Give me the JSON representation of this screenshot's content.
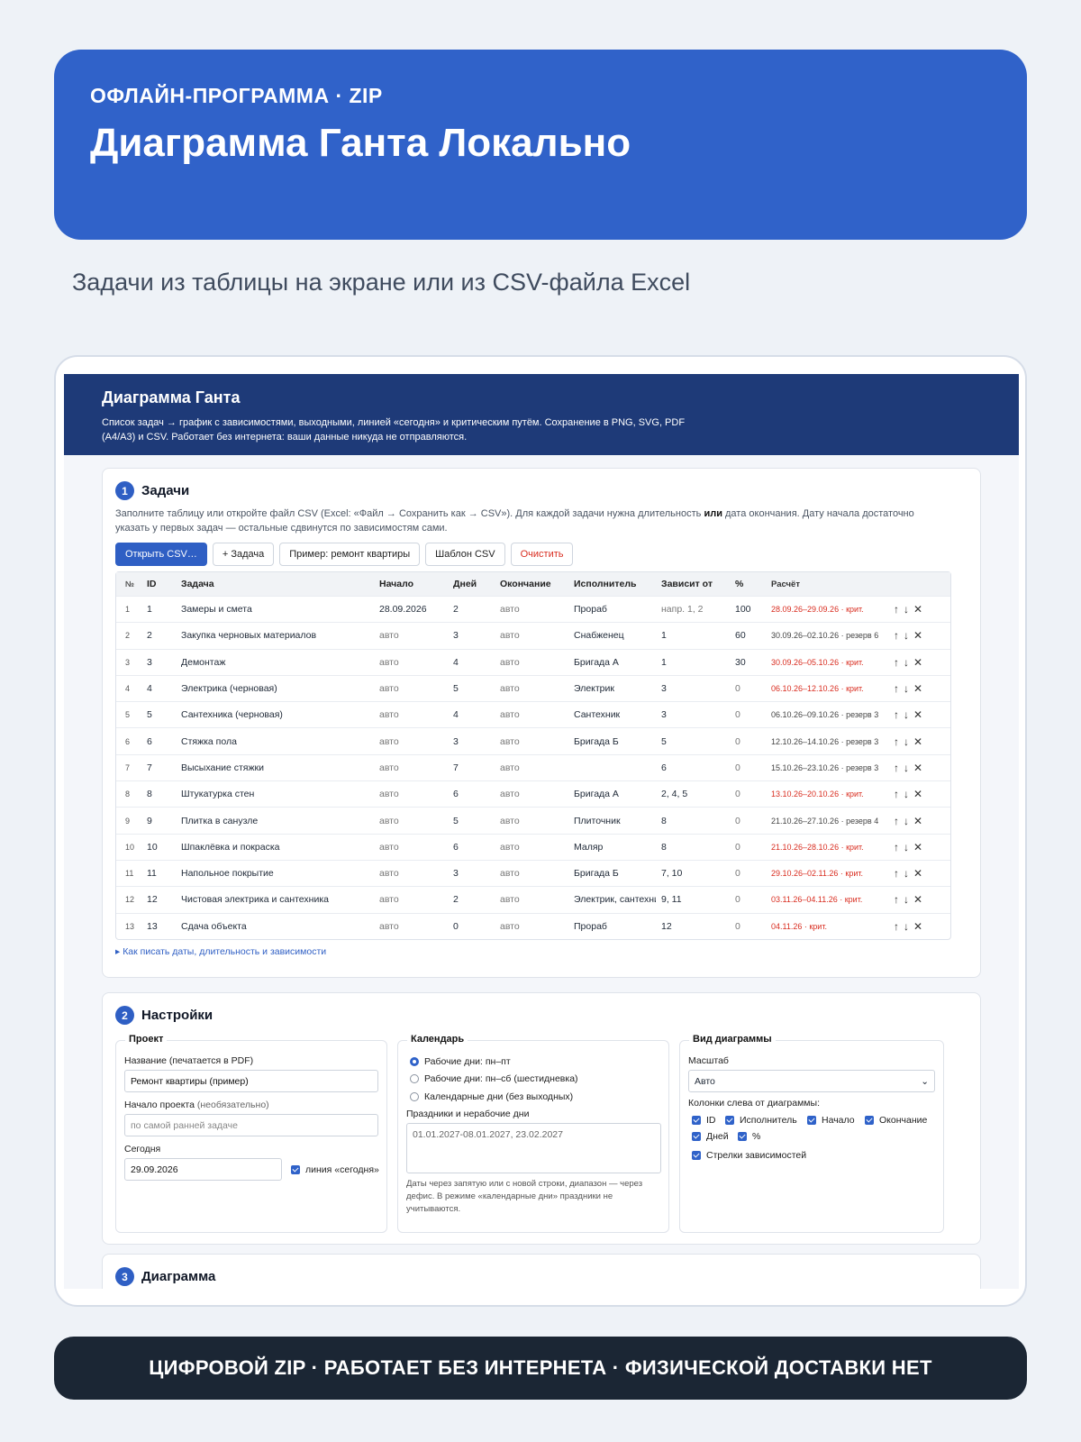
{
  "hero": {
    "kicker": "ОФЛАЙН-ПРОГРАММА · ZIP",
    "title": "Диаграмма Ганта Локально"
  },
  "subtitle": "Задачи из таблицы на экране или из CSV-файла Excel",
  "app": {
    "title": "Диаграмма Ганта",
    "description": "Список задач → график с зависимостями, выходными, линией «сегодня» и критическим путём. Сохранение в PNG, SVG, PDF (A4/A3) и CSV. Работает без интернета: ваши данные никуда не отправляются."
  },
  "tasks": {
    "number": "1",
    "title": "Задачи",
    "hint_pre": "Заполните таблицу или откройте файл CSV (Excel: «Файл → Сохранить как → CSV»). Для каждой задачи нужна длительность ",
    "hint_bold": "или",
    "hint_post": " дата окончания. Дату начала достаточно указать у первых задач — остальные сдвинутся по зависимостям сами.",
    "buttons": {
      "open_csv": "Открыть CSV…",
      "add_task": "+ Задача",
      "example": "Пример: ремонт квартиры",
      "template": "Шаблон CSV",
      "clear": "Очистить"
    },
    "columns": {
      "no": "№",
      "id": "ID",
      "name": "Задача",
      "start": "Начало",
      "days": "Дней",
      "end": "Окончание",
      "assignee": "Исполнитель",
      "depends": "Зависит от",
      "pct": "%",
      "calc": "Расчёт"
    },
    "rows": [
      {
        "no": "1",
        "id": "1",
        "name": "Замеры и смета",
        "start": "28.09.2026",
        "days": "2",
        "end": "авто",
        "assignee": "Прораб",
        "depends": "напр. 1, 2",
        "pct": "100",
        "calc": "28.09.26–29.09.26 · крит.",
        "crit": true
      },
      {
        "no": "2",
        "id": "2",
        "name": "Закупка черновых материалов",
        "start": "авто",
        "days": "3",
        "end": "авто",
        "assignee": "Снабженец",
        "depends": "1",
        "pct": "60",
        "calc": "30.09.26–02.10.26 · резерв 6",
        "crit": false
      },
      {
        "no": "3",
        "id": "3",
        "name": "Демонтаж",
        "start": "авто",
        "days": "4",
        "end": "авто",
        "assignee": "Бригада А",
        "depends": "1",
        "pct": "30",
        "calc": "30.09.26–05.10.26 · крит.",
        "crit": true
      },
      {
        "no": "4",
        "id": "4",
        "name": "Электрика (черновая)",
        "start": "авто",
        "days": "5",
        "end": "авто",
        "assignee": "Электрик",
        "depends": "3",
        "pct": "0",
        "calc": "06.10.26–12.10.26 · крит.",
        "crit": true
      },
      {
        "no": "5",
        "id": "5",
        "name": "Сантехника (черновая)",
        "start": "авто",
        "days": "4",
        "end": "авто",
        "assignee": "Сантехник",
        "depends": "3",
        "pct": "0",
        "calc": "06.10.26–09.10.26 · резерв 3",
        "crit": false
      },
      {
        "no": "6",
        "id": "6",
        "name": "Стяжка пола",
        "start": "авто",
        "days": "3",
        "end": "авто",
        "assignee": "Бригада Б",
        "depends": "5",
        "pct": "0",
        "calc": "12.10.26–14.10.26 · резерв 3",
        "crit": false
      },
      {
        "no": "7",
        "id": "7",
        "name": "Высыхание стяжки",
        "start": "авто",
        "days": "7",
        "end": "авто",
        "assignee": "",
        "depends": "6",
        "pct": "0",
        "calc": "15.10.26–23.10.26 · резерв 3",
        "crit": false
      },
      {
        "no": "8",
        "id": "8",
        "name": "Штукатурка стен",
        "start": "авто",
        "days": "6",
        "end": "авто",
        "assignee": "Бригада А",
        "depends": "2, 4, 5",
        "pct": "0",
        "calc": "13.10.26–20.10.26 · крит.",
        "crit": true
      },
      {
        "no": "9",
        "id": "9",
        "name": "Плитка в санузле",
        "start": "авто",
        "days": "5",
        "end": "авто",
        "assignee": "Плиточник",
        "depends": "8",
        "pct": "0",
        "calc": "21.10.26–27.10.26 · резерв 4",
        "crit": false
      },
      {
        "no": "10",
        "id": "10",
        "name": "Шпаклёвка и покраска",
        "start": "авто",
        "days": "6",
        "end": "авто",
        "assignee": "Маляр",
        "depends": "8",
        "pct": "0",
        "calc": "21.10.26–28.10.26 · крит.",
        "crit": true
      },
      {
        "no": "11",
        "id": "11",
        "name": "Напольное покрытие",
        "start": "авто",
        "days": "3",
        "end": "авто",
        "assignee": "Бригада Б",
        "depends": "7, 10",
        "pct": "0",
        "calc": "29.10.26–02.11.26 · крит.",
        "crit": true
      },
      {
        "no": "12",
        "id": "12",
        "name": "Чистовая электрика и сантехника",
        "start": "авто",
        "days": "2",
        "end": "авто",
        "assignee": "Электрик, сантехник",
        "depends": "9, 11",
        "pct": "0",
        "calc": "03.11.26–04.11.26 · крит.",
        "crit": true
      },
      {
        "no": "13",
        "id": "13",
        "name": "Сдача объекта",
        "start": "авто",
        "days": "0",
        "end": "авто",
        "assignee": "Прораб",
        "depends": "12",
        "pct": "0",
        "calc": "04.11.26 · крит.",
        "crit": true
      }
    ],
    "actions": {
      "up": "↑",
      "down": "↓",
      "remove": "✕"
    },
    "details": "▸ Как писать даты, длительность и зависимости"
  },
  "settings": {
    "number": "2",
    "title": "Настройки",
    "project": {
      "legend": "Проект",
      "name_label": "Название (печатается в PDF)",
      "name_value": "Ремонт квартиры (пример)",
      "start_label": "Начало проекта",
      "start_label_note": "(необязательно)",
      "start_placeholder": "по самой ранней задаче",
      "today_label": "Сегодня",
      "today_value": "29.09.2026",
      "today_line": "линия «сегодня»"
    },
    "calendar": {
      "legend": "Календарь",
      "options": [
        "Рабочие дни: пн–пт",
        "Рабочие дни: пн–сб (шестидневка)",
        "Календарные дни (без выходных)"
      ],
      "holidays_label": "Праздники и нерабочие дни",
      "holidays_placeholder": "01.01.2027-08.01.2027, 23.02.2027",
      "note": "Даты через запятую или с новой строки, диапазон — через дефис. В режиме «календарные дни» праздники не учитываются."
    },
    "view": {
      "legend": "Вид диаграммы",
      "scale_label": "Масштаб",
      "scale_value": "Авто",
      "columns_label": "Колонки слева от диаграммы:",
      "col_id": "ID",
      "col_assignee": "Исполнитель",
      "col_start": "Начало",
      "col_end": "Окончание",
      "col_days": "Дней",
      "col_pct": "%",
      "arrows": "Стрелки зависимостей"
    }
  },
  "chart_section": {
    "number": "3",
    "title": "Диаграмма"
  },
  "footer": "ЦИФРОВОЙ ZIP · РАБОТАЕТ БЕЗ ИНТЕРНЕТА · ФИЗИЧЕСКОЙ ДОСТАВКИ НЕТ",
  "colors": {
    "accent": "#3062c9",
    "header": "#1e3a78",
    "critical": "#d92d20",
    "footer": "#1b2634"
  }
}
